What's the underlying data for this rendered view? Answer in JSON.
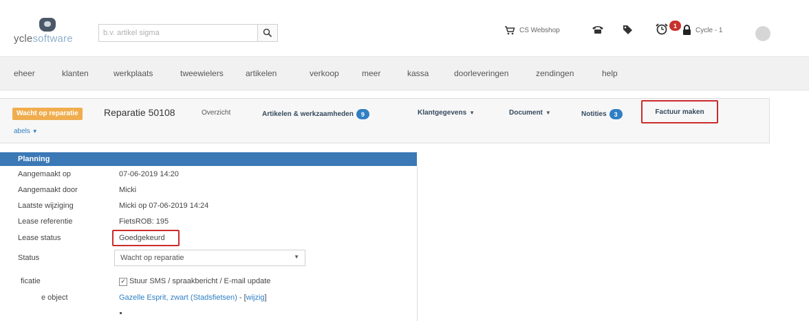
{
  "header": {
    "logo_text_dark": "ycle",
    "logo_text_light": "software",
    "search_placeholder": "b.v. artikel sigma",
    "webshop_label": "CS Webshop",
    "alarm_count": "1",
    "user_label": "Cycle - 1"
  },
  "nav": {
    "items": [
      "eheer",
      "klanten",
      "werkplaats",
      "tweewielers",
      "artikelen",
      "verkoop",
      "meer",
      "kassa",
      "doorleveringen",
      "zendingen",
      "help"
    ]
  },
  "subnav": {
    "status": "Wacht op reparatie",
    "title": "Reparatie 50108",
    "tabs": {
      "overzicht": "Overzicht",
      "artikelen": "Artikelen & werkzaamheden",
      "artikelen_count": "9",
      "klantgegevens": "Klantgegevens",
      "document": "Document",
      "notities": "Notities",
      "notities_count": "3",
      "factuur": "Factuur maken"
    },
    "labels": "abels"
  },
  "planning": {
    "header": "Planning",
    "rows": [
      {
        "label": "Aangemaakt op",
        "value": "07-06-2019 14:20"
      },
      {
        "label": "Aangemaakt door",
        "value": "Micki"
      },
      {
        "label": "Laatste wijziging",
        "value": "Micki op 07-06-2019 14:24"
      },
      {
        "label": "Lease referentie",
        "value": "FietsROB: 195"
      },
      {
        "label": "Lease status",
        "value": "Goedgekeurd"
      }
    ],
    "status_label": "Status",
    "status_value": "Wacht op reparatie",
    "notificatie_label": "ficatie",
    "sms_label": "Stuur SMS / spraakbericht / E-mail update",
    "object_label": "e object",
    "object_value": "Gazelle Esprit, zwart (Stadsfietsen)",
    "object_sep": " - [",
    "object_edit": "wijzig",
    "object_close": "]"
  }
}
